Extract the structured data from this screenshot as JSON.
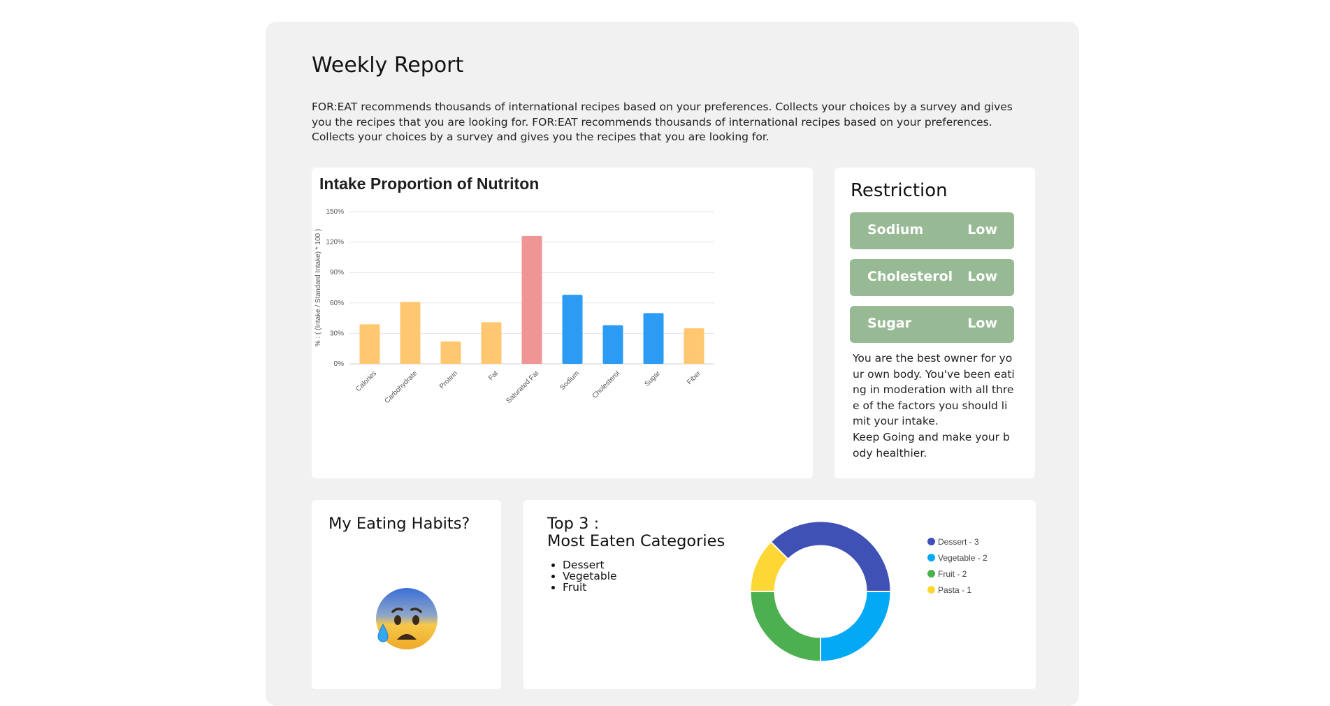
{
  "report": {
    "title": "Weekly Report",
    "description": "FOR:EAT recommends thousands of international recipes based on your preferences. Collects your choices by a survey and gives you the recipes that you are looking for. FOR:EAT recommends thousands of international recipes based on your preferences. Collects your choices by a survey and gives you the recipes that you are looking for."
  },
  "chart_data": [
    {
      "type": "bar",
      "title": "Intake Proportion of Nutriton",
      "ylabel": "% : ( (Intake / Standard Intake) * 100 )",
      "xlabel": "",
      "ylim": [
        0,
        150
      ],
      "ytick_labels": [
        "0%",
        "30%",
        "60%",
        "90%",
        "120%",
        "150%"
      ],
      "grid": true,
      "categories": [
        "Calories",
        "Carbohydrate",
        "Protein",
        "Fat",
        "Saturated Fat",
        "Sodium",
        "Cholesterol",
        "Sugar",
        "Fiber"
      ],
      "values": [
        39,
        61,
        22,
        41,
        126,
        68,
        38,
        50,
        35
      ],
      "colors": [
        "#ffc870",
        "#ffc870",
        "#ffc870",
        "#ffc870",
        "#ef9595",
        "#2b9bf4",
        "#2b9bf4",
        "#2b9bf4",
        "#ffc870"
      ]
    },
    {
      "type": "pie",
      "title": "",
      "categories": [
        "Dessert",
        "Vegetable",
        "Fruit",
        "Pasta"
      ],
      "values": [
        3,
        2,
        2,
        1
      ],
      "colors": [
        "#3f51b5",
        "#03a9f4",
        "#4caf50",
        "#fdd835"
      ],
      "legend": [
        "Dessert - 3",
        "Vegetable - 2",
        "Fruit - 2",
        "Pasta - 1"
      ],
      "legend_position": "right"
    }
  ],
  "restriction": {
    "title": "Restriction",
    "items": [
      {
        "name": "Sodium",
        "level": "Low"
      },
      {
        "name": "Cholesterol",
        "level": "Low"
      },
      {
        "name": "Sugar",
        "level": "Low"
      }
    ],
    "message": "You are the best owner for your own body. You've been eating in moderation with all three of the factors you should limit your intake.\nKeep Going and make your body healthier."
  },
  "habits": {
    "title": "My Eating Habits?",
    "emoji": "anxious-face-with-sweat-icon"
  },
  "top3": {
    "title_line1": "Top 3 :",
    "title_line2": "Most Eaten Categories",
    "list": [
      "Dessert",
      "Vegetable",
      "Fruit"
    ]
  }
}
